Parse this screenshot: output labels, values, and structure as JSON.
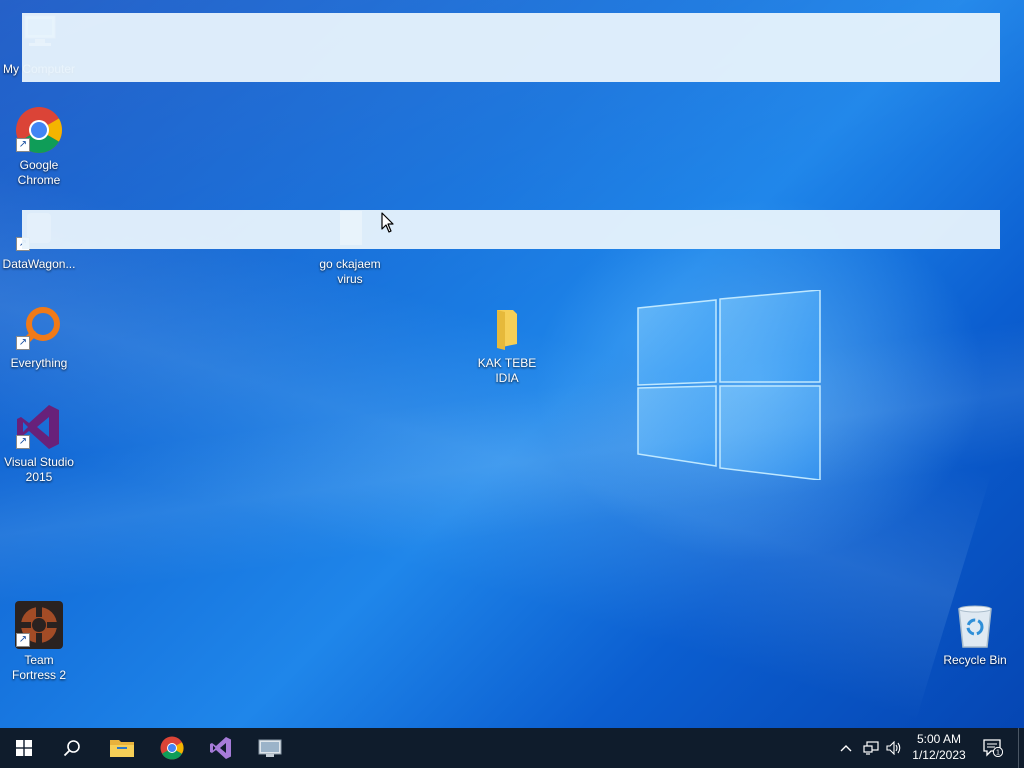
{
  "desktop": {
    "icons": [
      {
        "label": "My Computer"
      },
      {
        "label": "Google Chrome"
      },
      {
        "label": "DataWagon..."
      },
      {
        "label": "go ckajaem virus"
      },
      {
        "label": "Everything"
      },
      {
        "label": "KAK TEBE IDIA"
      },
      {
        "label": "Visual Studio 2015"
      },
      {
        "label": "Team Fortress 2"
      },
      {
        "label": "Recycle Bin"
      }
    ]
  },
  "taskbar": {
    "start": "start-icon",
    "search": "search-icon",
    "pinned": [
      "file-explorer-icon",
      "chrome-icon",
      "visual-studio-icon",
      "app-icon"
    ],
    "tray": {
      "icons": [
        "chevron-up-icon",
        "network-icon",
        "volume-icon"
      ],
      "time": "5:00 AM",
      "date": "1/12/2023",
      "notification_count": "1"
    }
  },
  "colors": {
    "desktop": "#1673dd",
    "taskbar": "#0f1c2c",
    "banner": "#e8f3fc"
  }
}
